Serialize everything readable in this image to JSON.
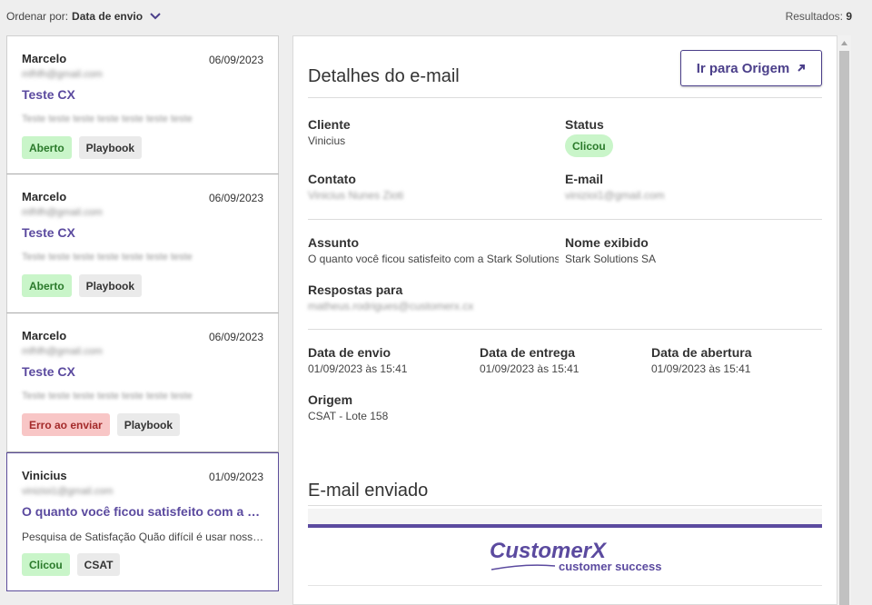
{
  "header": {
    "sort_prefix": "Ordenar por:",
    "sort_value": "Data de envio",
    "results_prefix": "Resultados:",
    "results_count": "9"
  },
  "cards": [
    {
      "name": "Marcelo",
      "date": "06/09/2023",
      "email": "mfhfh@gmail.com",
      "subject": "Teste CX",
      "preview": "Teste teste teste teste teste teste teste",
      "tags": [
        {
          "label": "Aberto",
          "color": "green"
        },
        {
          "label": "Playbook",
          "color": "grey"
        }
      ]
    },
    {
      "name": "Marcelo",
      "date": "06/09/2023",
      "email": "mfhfh@gmail.com",
      "subject": "Teste CX",
      "preview": "Teste teste teste teste teste teste teste",
      "tags": [
        {
          "label": "Aberto",
          "color": "green"
        },
        {
          "label": "Playbook",
          "color": "grey"
        }
      ]
    },
    {
      "name": "Marcelo",
      "date": "06/09/2023",
      "email": "mfhfh@gmail.com",
      "subject": "Teste CX",
      "preview": "Teste teste teste teste teste teste teste",
      "tags": [
        {
          "label": "Erro ao enviar",
          "color": "red"
        },
        {
          "label": "Playbook",
          "color": "grey"
        }
      ]
    },
    {
      "name": "Vinicius",
      "date": "01/09/2023",
      "email": "vinizioi1@gmail.com",
      "subject": "O quanto você ficou satisfeito com a Stark Solutions SA",
      "preview": "Pesquisa de Satisfação   Quão difícil é usar nosso produto?",
      "tags": [
        {
          "label": "Clicou",
          "color": "green"
        },
        {
          "label": "CSAT",
          "color": "grey"
        }
      ]
    }
  ],
  "detail": {
    "title": "Detalhes do e-mail",
    "origin_button": "Ir para Origem",
    "cliente_label": "Cliente",
    "cliente_value": "Vinicius",
    "status_label": "Status",
    "status_value": "Clicou",
    "contato_label": "Contato",
    "contato_value": "Vinicius Nunes Zioti",
    "email_label": "E-mail",
    "email_value": "vinizioi1@gmail.com",
    "assunto_label": "Assunto",
    "assunto_value": "O quanto você ficou satisfeito com a Stark Solutions SA",
    "nome_label": "Nome exibido",
    "nome_value": "Stark Solutions SA",
    "respostas_label": "Respostas para",
    "respostas_value": "matheus.rodrigues@customerx.cx",
    "envio_label": "Data de envio",
    "envio_value": "01/09/2023 às 15:41",
    "entrega_label": "Data de entrega",
    "entrega_value": "01/09/2023 às 15:41",
    "abertura_label": "Data de abertura",
    "abertura_value": "01/09/2023 às 15:41",
    "origem_label": "Origem",
    "origem_value": "CSAT - Lote 158",
    "sent_title": "E-mail enviado",
    "logo_main": "CustomerX",
    "logo_sub": "customer success"
  },
  "colors": {
    "accent": "#5b4a9f",
    "green_bg": "#c9f5c9",
    "red_bg": "#f8c6c6"
  }
}
